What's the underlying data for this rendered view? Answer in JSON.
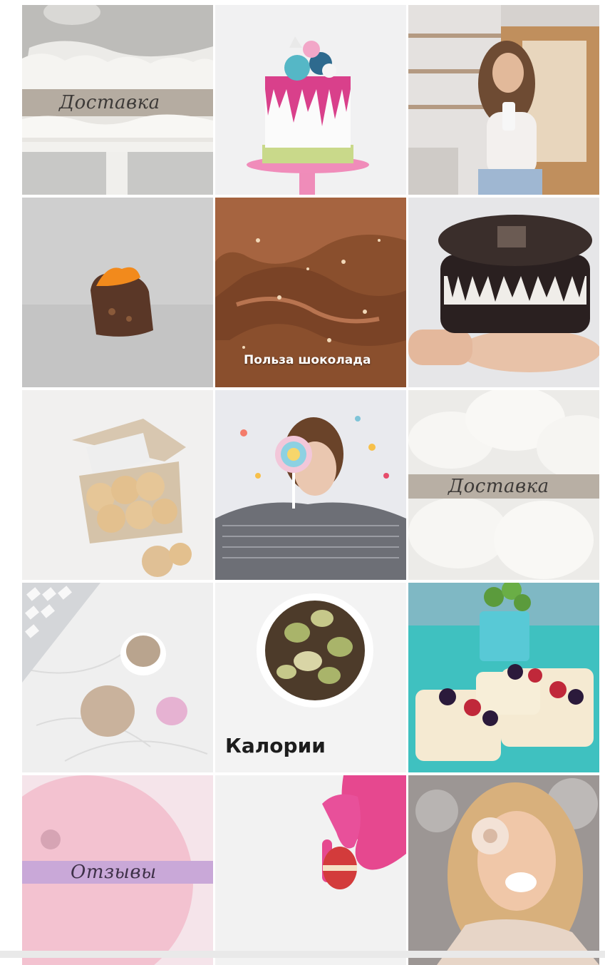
{
  "grid": {
    "tiles": [
      {
        "label": "Доставка",
        "subject": "whipped cream cake on white stand"
      },
      {
        "label": "",
        "subject": "white drip cake with pink glaze and macarons"
      },
      {
        "label": "",
        "subject": "woman drinking from cup in bakery"
      },
      {
        "label": "",
        "subject": "chocolate candy with orange zest"
      },
      {
        "label": "Польза шоколада",
        "subject": "chocolate frosting with sprinkles"
      },
      {
        "label": "",
        "subject": "hand holding oreo cheesecake"
      },
      {
        "label": "",
        "subject": "cookies in a gift box"
      },
      {
        "label": "",
        "subject": "girl with lollipop and confetti"
      },
      {
        "label": "Доставка",
        "subject": "white meringues"
      },
      {
        "label": "",
        "subject": "coffee, keyboard and cookies on marble"
      },
      {
        "label": "Калории",
        "subject": "pistachio chocolate cake"
      },
      {
        "label": "",
        "subject": "berry dessert cups on turquoise table"
      },
      {
        "label": "Отзывы",
        "subject": "pink plate"
      },
      {
        "label": "",
        "subject": "pink gloved hand holding macaron"
      },
      {
        "label": "",
        "subject": "laughing woman holding donut"
      }
    ]
  },
  "colors": {
    "band_beige": "#b8afa4",
    "band_lilac": "#c9a8d8",
    "chocolate": "#7a4a2e",
    "turquoise": "#3fc1c0",
    "pink": "#e6488f"
  }
}
